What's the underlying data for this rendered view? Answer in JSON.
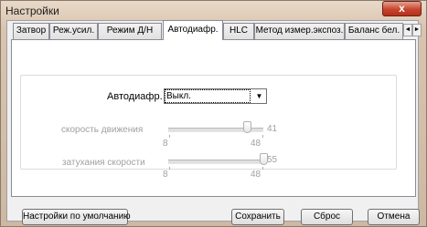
{
  "window": {
    "title": "Настройки",
    "close_symbol": "x"
  },
  "tabs": [
    {
      "label": "Затвор"
    },
    {
      "label": "Реж.усил."
    },
    {
      "label": "Режим Д/Н"
    },
    {
      "label": "Автодиафр.",
      "active": true
    },
    {
      "label": "HLC"
    },
    {
      "label": "Метод измер.экспоз."
    },
    {
      "label": "Баланс бел."
    }
  ],
  "tab_scroll": {
    "left": "◄",
    "right": "►"
  },
  "iris": {
    "label": "Автодиафр.",
    "value": "Выкл.",
    "dropdown_icon": "chevron-down-icon",
    "dropdown_glyph": "▼"
  },
  "speed": {
    "label": "скорость движения",
    "value": "41",
    "min": "8",
    "max": "48",
    "fraction": 0.83
  },
  "damping": {
    "label": "затухания скорости",
    "value": "55",
    "min": "8",
    "max": "48",
    "fraction": 1.0
  },
  "buttons": {
    "defaults": "Настройки по умолчанию",
    "save": "Сохранить",
    "reset": "Сброс",
    "cancel": "Отмена"
  },
  "colors": {
    "disabled_text": "#a0a0a0",
    "close_button": "#c7452e"
  }
}
